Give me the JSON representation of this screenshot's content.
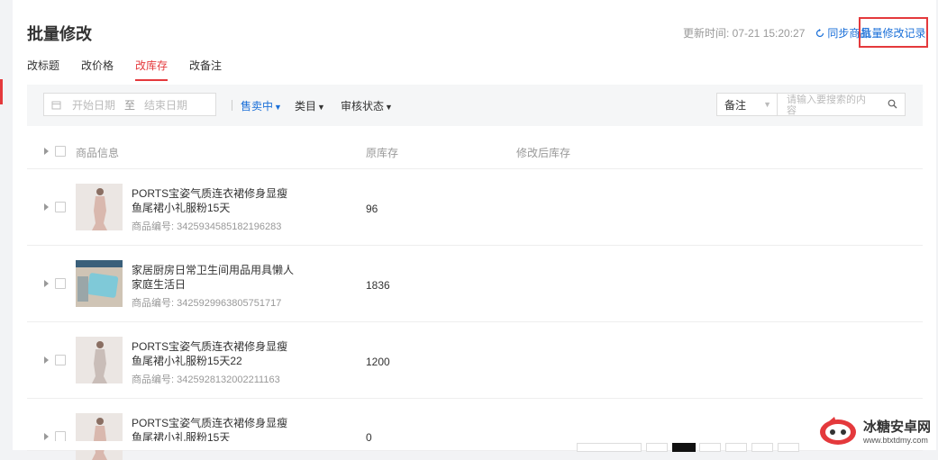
{
  "header": {
    "title": "批量修改",
    "update_time": "更新时间: 07-21 15:20:27",
    "sync_label": "同步商品",
    "records_label": "批量修改记录"
  },
  "tabs": [
    {
      "label": "改标题",
      "active": false
    },
    {
      "label": "改价格",
      "active": false
    },
    {
      "label": "改库存",
      "active": true
    },
    {
      "label": "改备注",
      "active": false
    }
  ],
  "filters": {
    "start_placeholder": "开始日期",
    "separator": "至",
    "end_placeholder": "结束日期",
    "status_label": "售卖中",
    "category_label": "类目",
    "audit_label": "审核状态",
    "search_field": "备注",
    "search_placeholder": "请输入要搜索的内容"
  },
  "table": {
    "columns": [
      "商品信息",
      "原库存",
      "修改后库存"
    ],
    "rows": [
      {
        "name": "PORTS宝姿气质连衣裙修身显瘦鱼尾裙小礼服粉15天",
        "id": "商品编号: 3425934585182196283",
        "stock": "96",
        "thumb": "dress"
      },
      {
        "name": "家居厨房日常卫生间用品用具懒人家庭生活日",
        "id": "商品编号: 3425929963805751717",
        "stock": "1836",
        "thumb": "mat"
      },
      {
        "name": "PORTS宝姿气质连衣裙修身显瘦鱼尾裙小礼服粉15天22",
        "id": "商品编号: 3425928132002211163",
        "stock": "1200",
        "thumb": "dress"
      },
      {
        "name": "PORTS宝姿气质连衣裙修身显瘦鱼尾裙小礼服粉15天",
        "id": "",
        "stock": "0",
        "thumb": "dress"
      }
    ]
  },
  "watermark": {
    "main": "冰糖安卓网",
    "sub": "www.btxtdmy.com"
  },
  "colors": {
    "accent": "#e4393c",
    "link": "#1a6fd8"
  }
}
